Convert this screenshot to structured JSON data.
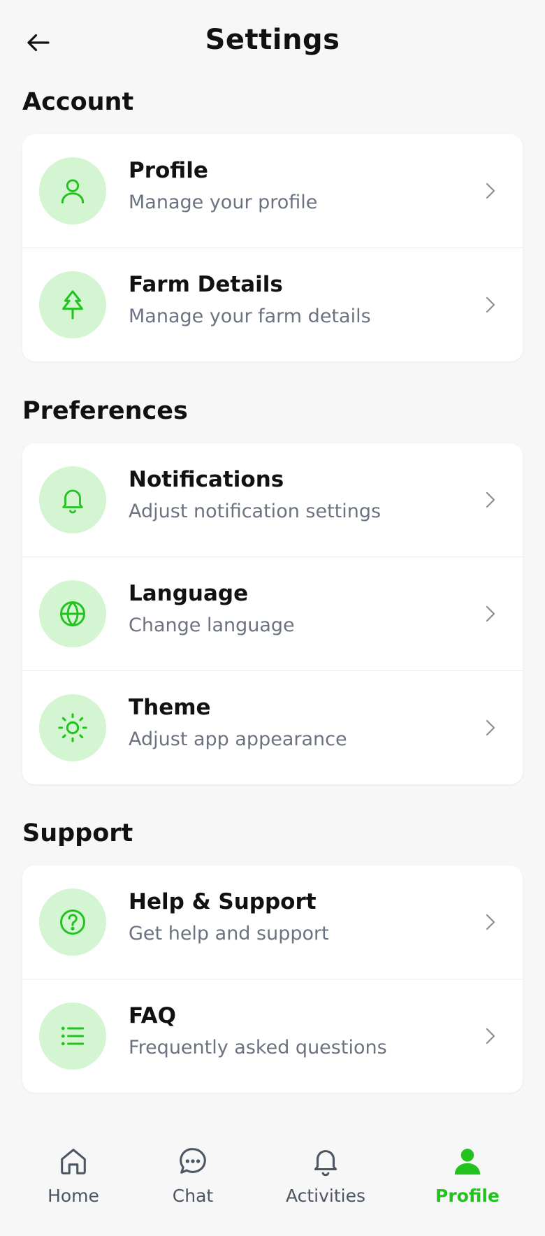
{
  "header": {
    "title": "Settings",
    "back_icon": "arrow-left-icon"
  },
  "colors": {
    "accent": "#22c31e",
    "icon_bg": "#d4f5d2",
    "background": "#f6f7f6",
    "subtitle": "#6b7280"
  },
  "sections": {
    "account": {
      "title": "Account",
      "items": [
        {
          "title": "Profile",
          "subtitle": "Manage your profile",
          "icon": "user-icon"
        },
        {
          "title": "Farm Details",
          "subtitle": "Manage your farm details",
          "icon": "tree-icon"
        }
      ]
    },
    "preferences": {
      "title": "Preferences",
      "items": [
        {
          "title": "Notifications",
          "subtitle": "Adjust notification settings",
          "icon": "bell-icon"
        },
        {
          "title": "Language",
          "subtitle": "Change language",
          "icon": "globe-icon"
        },
        {
          "title": "Theme",
          "subtitle": "Adjust app appearance",
          "icon": "sun-icon"
        }
      ]
    },
    "support": {
      "title": "Support",
      "items": [
        {
          "title": "Help & Support",
          "subtitle": "Get help and support",
          "icon": "help-circle-icon"
        },
        {
          "title": "FAQ",
          "subtitle": "Frequently asked questions",
          "icon": "list-icon"
        }
      ]
    }
  },
  "bottom_nav": {
    "items": [
      {
        "label": "Home",
        "icon": "home-icon"
      },
      {
        "label": "Chat",
        "icon": "chat-bubble-icon"
      },
      {
        "label": "Activities",
        "icon": "bell-icon"
      },
      {
        "label": "Profile",
        "icon": "user-filled-icon",
        "active": true
      }
    ]
  }
}
